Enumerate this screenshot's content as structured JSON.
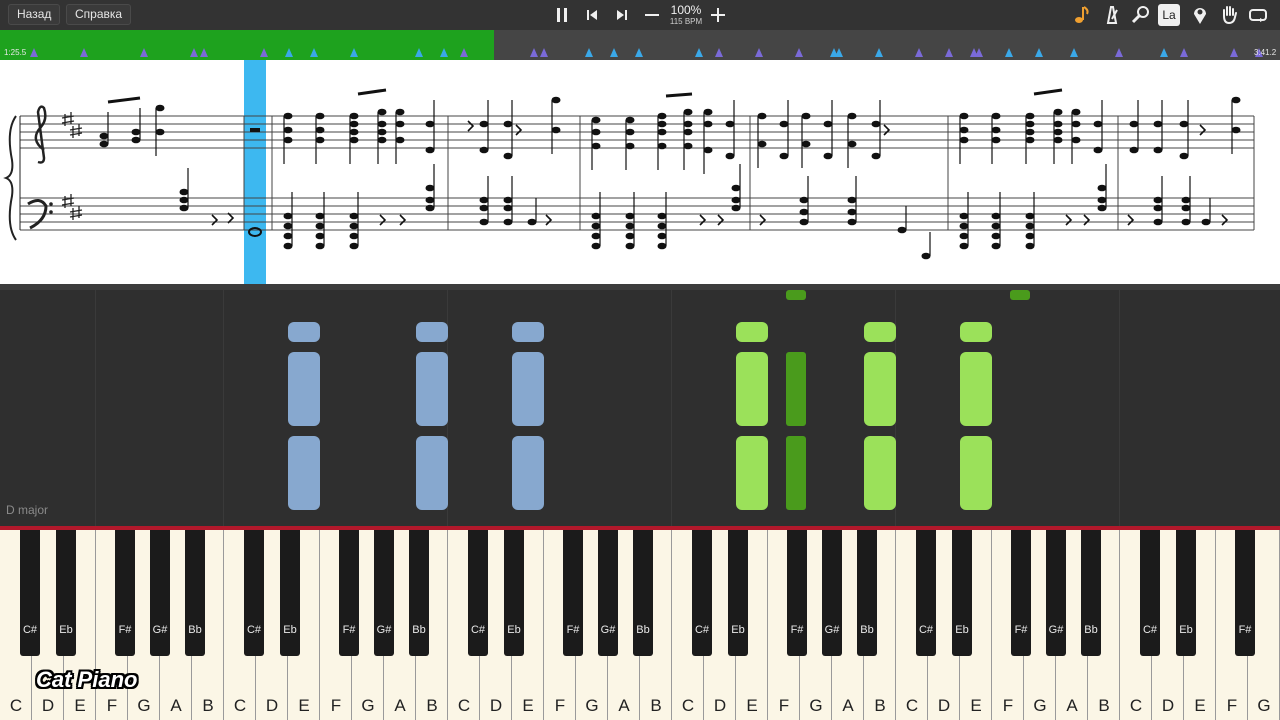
{
  "toolbar": {
    "back_label": "Назад",
    "help_label": "Справка",
    "zoom_percent": "100%",
    "tempo": "115 BPM",
    "icons": [
      "pause-icon",
      "skip-back-icon",
      "skip-forward-icon",
      "minus-icon",
      "plus-icon",
      "note-icon",
      "metronome-icon",
      "search-icon",
      "la-icon",
      "location-pin-icon",
      "hand-icon",
      "loop-icon"
    ],
    "la_label": "La"
  },
  "timeline": {
    "current_time": "1:25.5",
    "total_time": "3:41.2",
    "progress": 0.386,
    "progress_color": "#1ea21e"
  },
  "sheet": {
    "current_measure_highlight_color": "#3db8f0"
  },
  "falling_notes": {
    "key_signature_label": "D major",
    "colors": {
      "left_hand": "#87a8cf",
      "right_hand": "#9be15a",
      "right_hand_dark": "#4a9b1c"
    }
  },
  "keyboard": {
    "white_keys": [
      "C",
      "D",
      "E",
      "F",
      "G",
      "A",
      "B",
      "C",
      "D",
      "E",
      "F",
      "G",
      "A",
      "B",
      "C",
      "D",
      "E",
      "F",
      "G",
      "A",
      "B",
      "C",
      "D",
      "E",
      "F",
      "G",
      "A",
      "B",
      "C",
      "D",
      "E",
      "F",
      "G",
      "A",
      "B",
      "C",
      "D",
      "E",
      "F",
      "G"
    ],
    "black_key_labels": [
      "C#",
      "Eb",
      "F#",
      "G#",
      "Bb"
    ]
  },
  "branding": {
    "logo_text": "Cat Piano"
  }
}
